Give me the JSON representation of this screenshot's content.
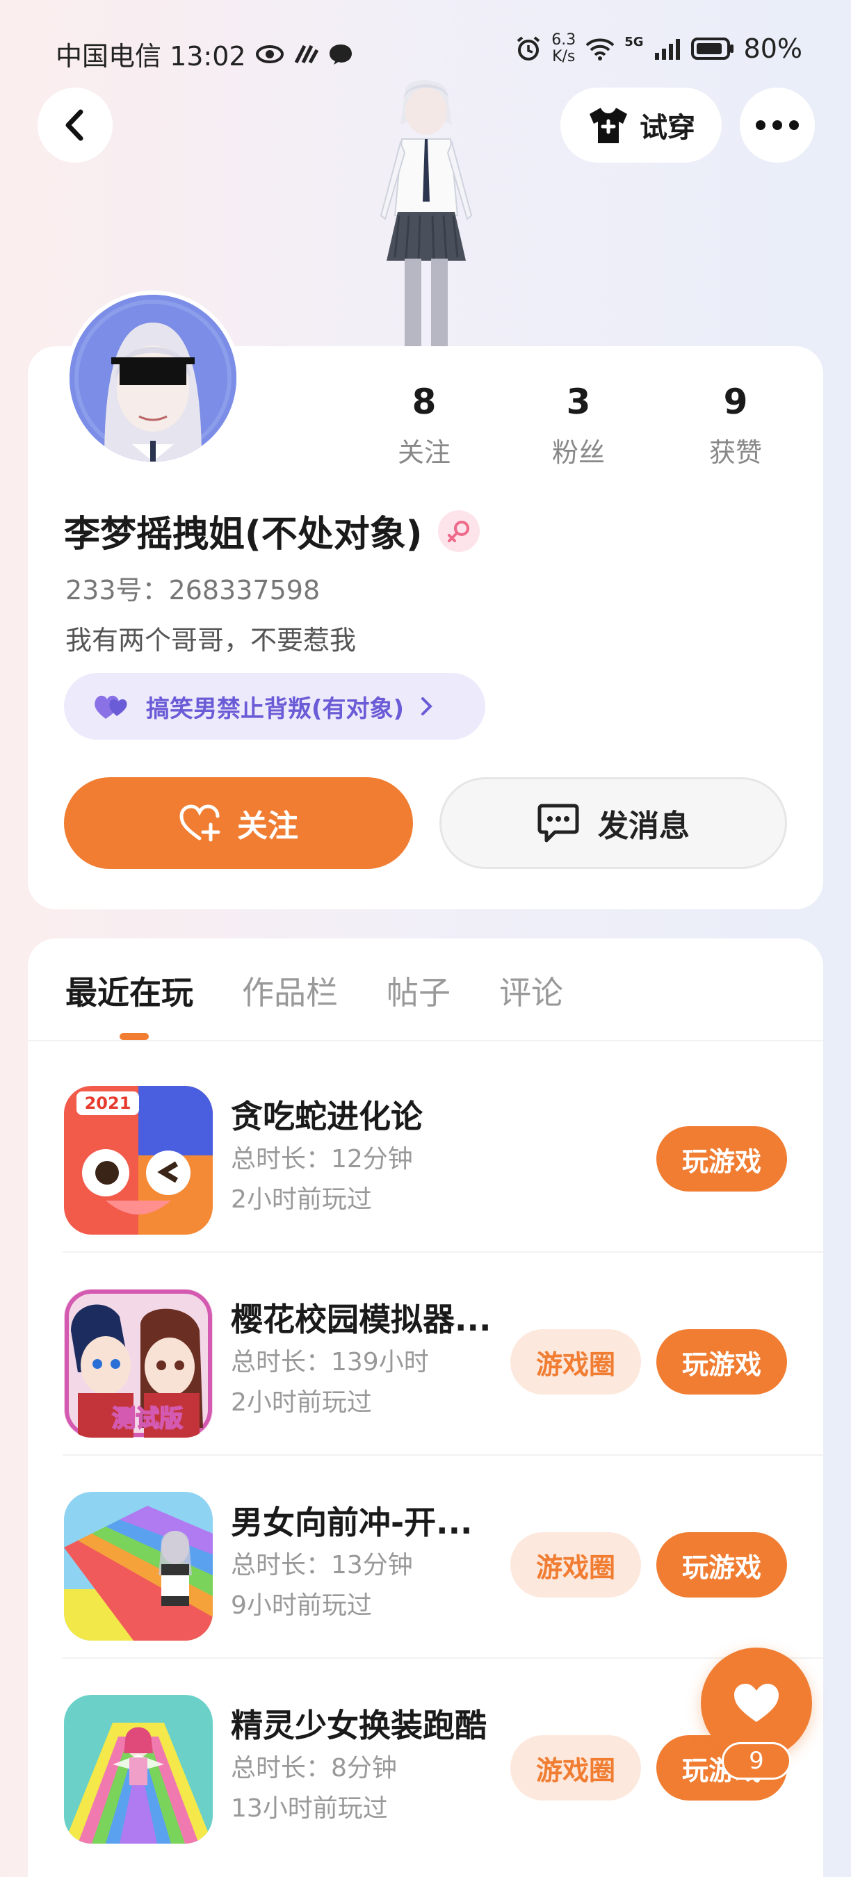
{
  "status_bar": {
    "carrier_time": "中国电信 13:02",
    "net_speed_value": "6.3",
    "net_speed_unit": "K/s",
    "network_type": "5G",
    "battery": "80%"
  },
  "header": {
    "try_on_label": "试穿"
  },
  "profile": {
    "stats": [
      {
        "value": "8",
        "label": "关注"
      },
      {
        "value": "3",
        "label": "粉丝"
      },
      {
        "value": "9",
        "label": "获赞"
      }
    ],
    "name": "李梦摇拽姐(不处对象)",
    "uid": "233号：268337598",
    "bio": "我有两个哥哥，不要惹我",
    "group_label": "搞笑男禁止背叛(有对象)",
    "follow_label": "关注",
    "message_label": "发消息"
  },
  "tabs": [
    {
      "label": "最近在玩"
    },
    {
      "label": "作品栏"
    },
    {
      "label": "帖子"
    },
    {
      "label": "评论"
    }
  ],
  "games": [
    {
      "name": "贪吃蛇进化论",
      "duration": "总时长：12分钟",
      "last_played": "2小时前玩过",
      "play_label": "玩游戏",
      "icon_badge": "2021"
    },
    {
      "name": "樱花校园模拟器...",
      "duration": "总时长：139小时",
      "last_played": "2小时前玩过",
      "circle_label": "游戏圈",
      "play_label": "玩游戏",
      "icon_badge": "测试版"
    },
    {
      "name": "男女向前冲-开...",
      "duration": "总时长：13分钟",
      "last_played": "9小时前玩过",
      "circle_label": "游戏圈",
      "play_label": "玩游戏"
    },
    {
      "name": "精灵少女换装跑酷",
      "duration": "总时长：8分钟",
      "last_played": "13小时前玩过",
      "circle_label": "游戏圈",
      "play_label": "玩游戏"
    }
  ],
  "like_fab": {
    "count": "9"
  },
  "colors": {
    "accent": "#f07d32",
    "group_pill_bg": "#edeafc",
    "group_pill_text": "#6a5bd6"
  }
}
